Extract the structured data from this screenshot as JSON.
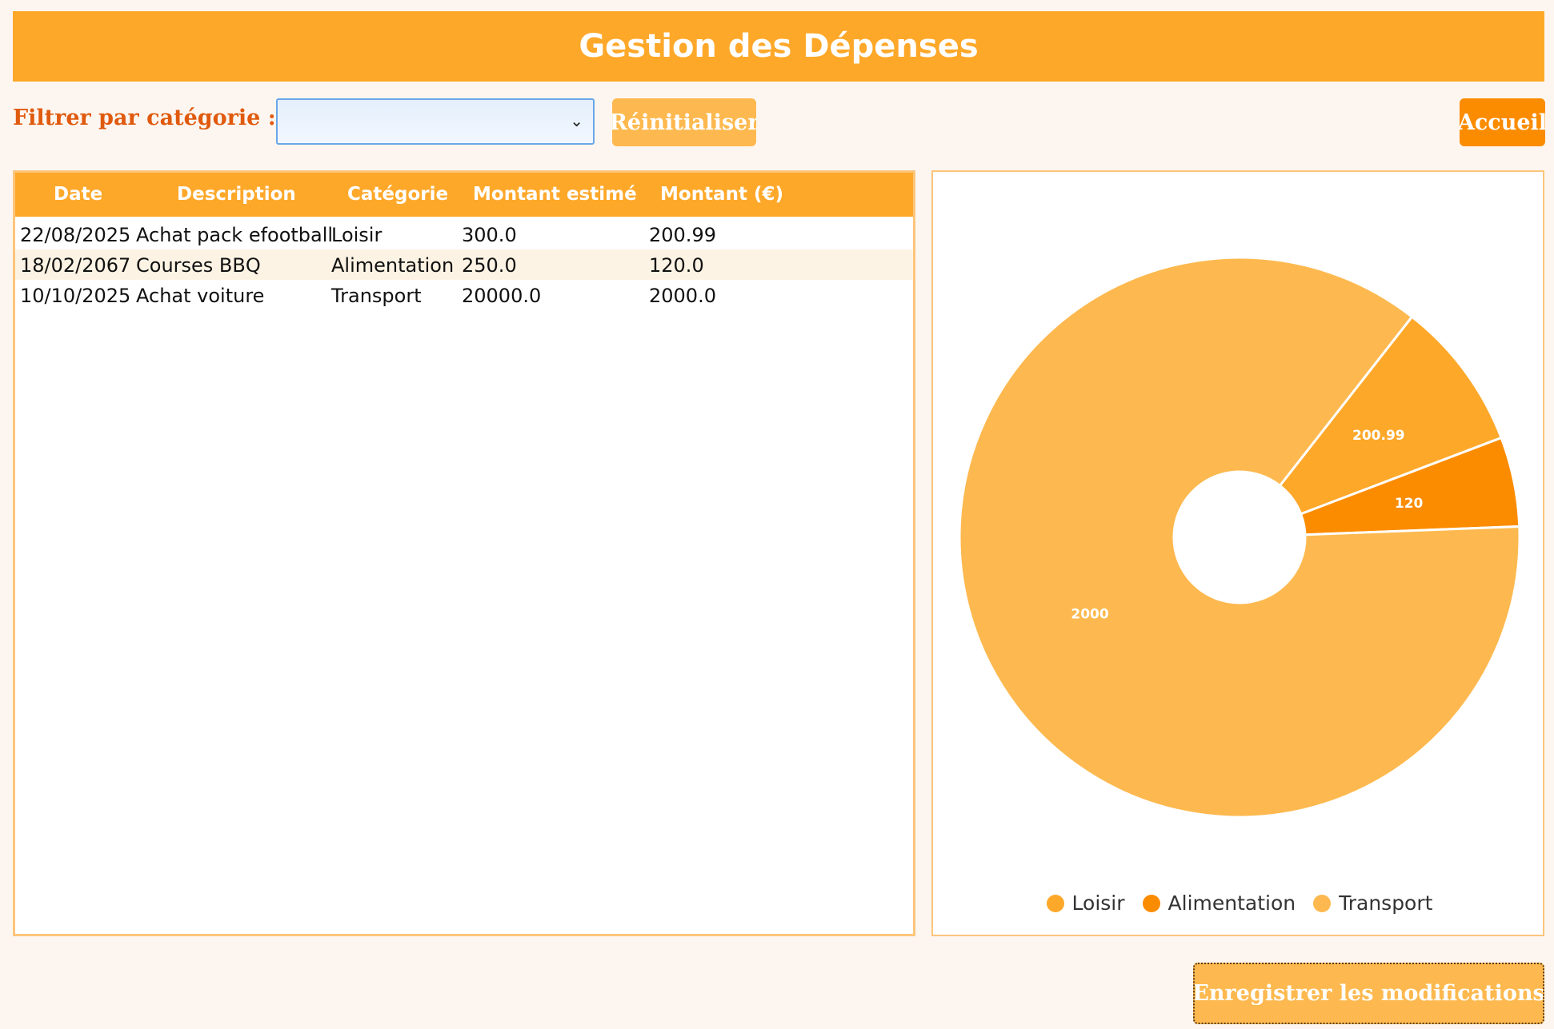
{
  "header": {
    "title": "Gestion des Dépenses"
  },
  "filter": {
    "label": "Filtrer par catégorie :",
    "selected": ""
  },
  "buttons": {
    "reset": "Réinitialiser",
    "home": "Accueil",
    "save": "Enregistrer les modifications"
  },
  "table": {
    "columns": [
      "Date",
      "Description",
      "Catégorie",
      "Montant estimé",
      "Montant (€)"
    ],
    "rows": [
      [
        "22/08/2025",
        "Achat pack efootball",
        "Loisir",
        "300.0",
        "200.99"
      ],
      [
        "18/02/2067",
        "Courses BBQ",
        "Alimentation",
        "250.0",
        "120.0"
      ],
      [
        "10/10/2025",
        "Achat voiture",
        "Transport",
        "20000.0",
        "2000.0"
      ]
    ]
  },
  "chart_data": {
    "type": "pie",
    "donut": true,
    "categories": [
      "Loisir",
      "Alimentation",
      "Transport"
    ],
    "values": [
      200.99,
      120,
      2000
    ],
    "labels": [
      "200.99",
      "120",
      "2000"
    ],
    "colors": [
      "#fea82a",
      "#fb8c00",
      "#fdb94f"
    ],
    "legend_position": "bottom"
  }
}
